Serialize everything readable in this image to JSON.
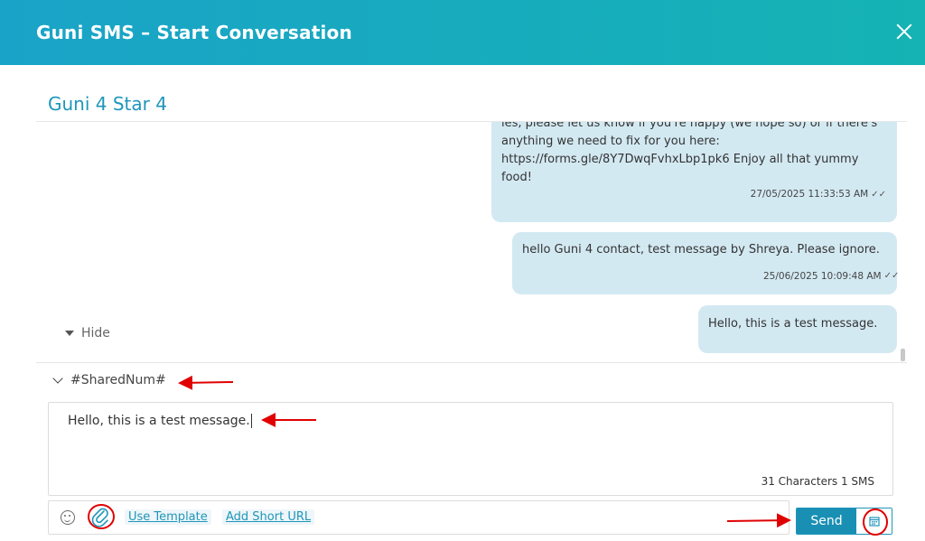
{
  "header": {
    "title": "Guni SMS – Start Conversation"
  },
  "contact": {
    "name": "Guni 4 Star 4"
  },
  "messages": [
    {
      "lines": [
        "les, please let us know if you're happy (we hope so) or if there's",
        "anything we need to fix for you here:",
        "https://forms.gle/8Y7DwqFvhxLbp1pk6 Enjoy all that yummy",
        "food!"
      ],
      "time": "27/05/2025 11:33:53 AM"
    },
    {
      "text": "hello Guni 4 contact, test message by Shreya. Please ignore.",
      "time": "25/06/2025 10:09:48 AM"
    },
    {
      "text": "Hello, this is a test message."
    }
  ],
  "hide_label": "Hide",
  "sender": {
    "label": "#SharedNum#"
  },
  "compose": {
    "text": "Hello, this is a test message.",
    "count": "31 Characters  1 SMS"
  },
  "toolbar": {
    "use_template": "Use Template",
    "add_short_url": "Add Short URL"
  },
  "send": {
    "label": "Send"
  },
  "icons": {
    "close": "close-icon",
    "emoji": "emoji-icon",
    "attach": "paperclip-icon",
    "schedule": "calendar-icon",
    "check": "double-check-icon"
  },
  "colors": {
    "header_start": "#1aa3c8",
    "header_end": "#15b3b4",
    "bubble": "#d3e9f2",
    "accent": "#1e96b9",
    "annotation": "#e00000"
  }
}
